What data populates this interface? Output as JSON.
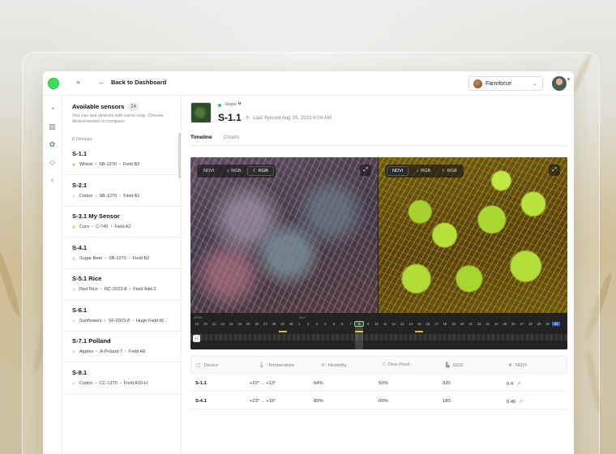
{
  "topbar": {
    "back_label": "Back to Dashboard",
    "collapse_icon": "double-chevron-right",
    "org_name": "Farmforce"
  },
  "rail_icons": [
    "dashboard-icon",
    "map-icon",
    "flower-icon",
    "tag-icon",
    "sprout-icon"
  ],
  "sensors_panel": {
    "title": "Available sensors",
    "count": "24",
    "hint": "You can see devices with same crop. Choose device/sensor to compare.",
    "devices_label": "8 Devices",
    "items": [
      {
        "name": "S-1.1",
        "crop": "Wheat",
        "model": "SB-1270",
        "field": "Field B2",
        "dot": "#e6d59a"
      },
      {
        "name": "S-2.1",
        "crop": "Cotton",
        "model": "SB-1270",
        "field": "Field A1",
        "dot": "#e7e7e7"
      },
      {
        "name": "S-3.1 My Sensor",
        "crop": "Corn",
        "model": "C-745",
        "field": "Field A2",
        "dot": "#f2d77a"
      },
      {
        "name": "S-4.1",
        "crop": "Sugar Beet",
        "model": "SB-1270",
        "field": "Field B2",
        "dot": "#dcdcdc"
      },
      {
        "name": "S-5.1 Rice",
        "crop": "Red Rice",
        "model": "RC-2023-8",
        "field": "Field Add-2",
        "dot": "#e6e6e6"
      },
      {
        "name": "S-6.1",
        "crop": "Sunflowers",
        "model": "SF-2023-8",
        "field": "Huge Field W...",
        "dot": "#ececec"
      },
      {
        "name": "S-7.1 Polland",
        "crop": "Apples",
        "model": "A-Poland-7",
        "field": "Field A8",
        "dot": "#e3e3e3"
      },
      {
        "name": "S-8.1",
        "crop": "Cotton",
        "model": "CC-1270",
        "field": "Field A10-H",
        "dot": "#e6e6e6"
      }
    ]
  },
  "device": {
    "crop": "Rape",
    "name": "S-1.1",
    "last_synced": "Last Synced Aug 29, 2023 6:04 AM",
    "status_color": "#33c452"
  },
  "tabs": [
    {
      "label": "Timeline",
      "active": true
    },
    {
      "label": "Charts",
      "active": false
    }
  ],
  "viewer": {
    "left": {
      "options": [
        "NDVI",
        "RGB",
        "RGB"
      ],
      "icons": [
        "",
        "sun-icon",
        "moon-icon"
      ],
      "selected": 2
    },
    "right": {
      "options": [
        "NDVI",
        "RGB",
        "RGB"
      ],
      "icons": [
        "",
        "sun-icon",
        "moon-icon"
      ],
      "selected": 0
    },
    "timeline": {
      "months": [
        "APRIL",
        "MAY"
      ],
      "days": [
        "19",
        "20",
        "21",
        "22",
        "23",
        "24",
        "25",
        "26",
        "27",
        "28",
        "29",
        "30",
        "1",
        "2",
        "3",
        "4",
        "5",
        "6",
        "7",
        "8",
        "9",
        "10",
        "11",
        "12",
        "13",
        "14",
        "15",
        "16",
        "17",
        "18",
        "19",
        "20",
        "21",
        "22",
        "23",
        "24",
        "25",
        "26",
        "27",
        "28",
        "29",
        "30",
        "31"
      ],
      "selected_day_index": 19,
      "marked_day_indices": [
        10,
        19,
        26
      ],
      "current_day_index": 42
    }
  },
  "table": {
    "headers": [
      {
        "label": "Device",
        "icon": "device-icon"
      },
      {
        "label": "Temperature",
        "icon": "thermometer-icon"
      },
      {
        "label": "Humidity",
        "icon": "humidity-icon"
      },
      {
        "label": "Dew Point",
        "icon": "droplet-icon"
      },
      {
        "label": "GDD",
        "icon": "chart-icon"
      },
      {
        "label": "NDVI",
        "icon": "leaf-icon"
      }
    ],
    "rows": [
      {
        "device": "S-1.1",
        "temperature": "+22° ... +13°",
        "humidity": "64%",
        "dew_point": "50%",
        "gdd": "320",
        "ndvi": "0.4"
      },
      {
        "device": "S-4.1",
        "temperature": "+23° ... +15°",
        "humidity": "80%",
        "dew_point": "60%",
        "gdd": "180",
        "ndvi": "0.45"
      }
    ]
  }
}
